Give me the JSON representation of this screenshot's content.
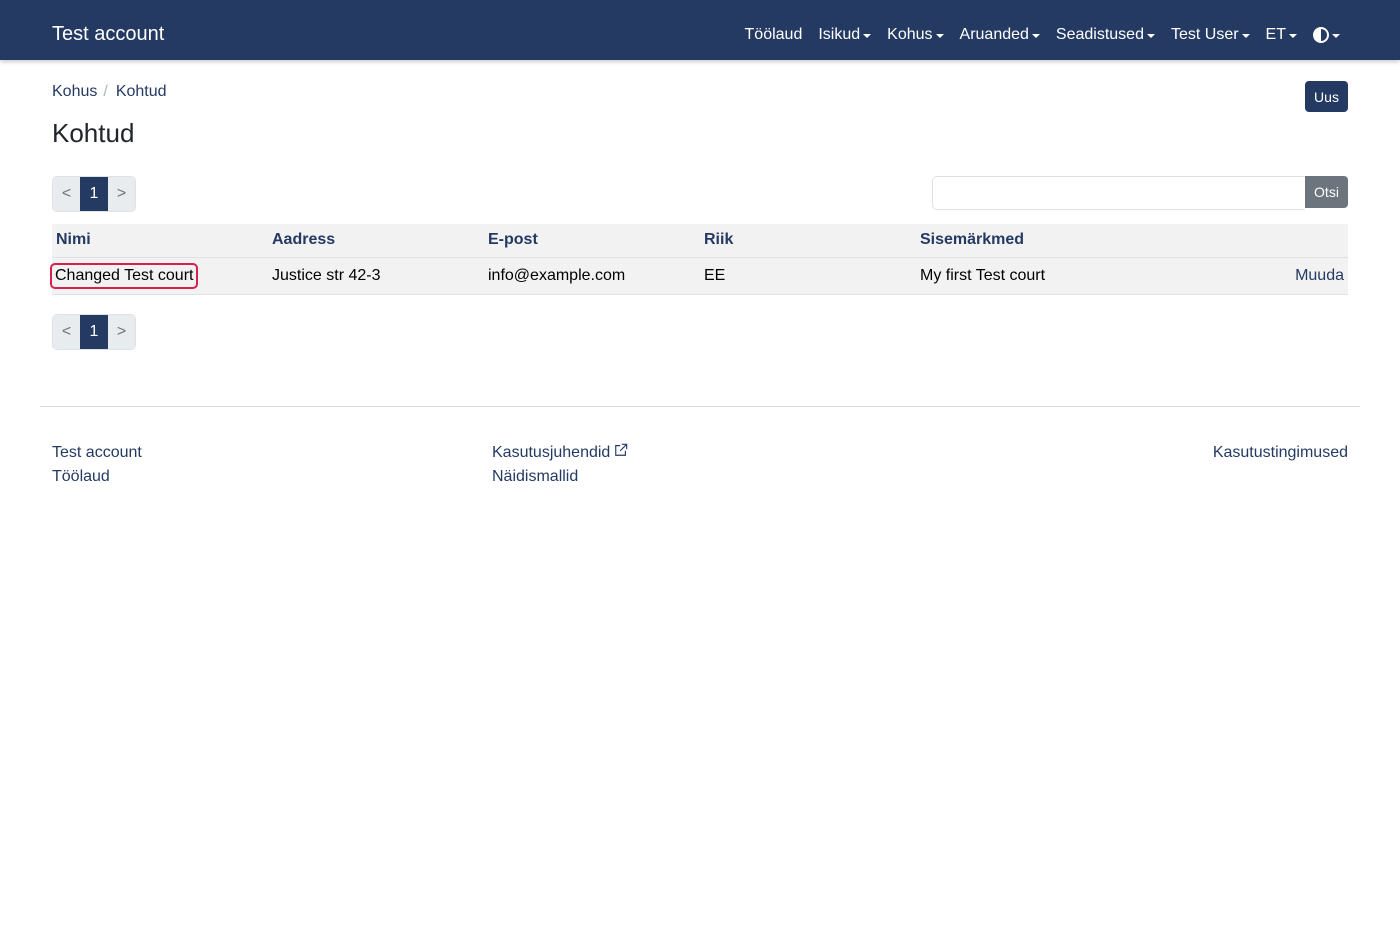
{
  "navbar": {
    "brand": "Test account",
    "items": [
      {
        "label": "Töölaud",
        "dropdown": false
      },
      {
        "label": "Isikud",
        "dropdown": true
      },
      {
        "label": "Kohus",
        "dropdown": true
      },
      {
        "label": "Aruanded",
        "dropdown": true
      },
      {
        "label": "Seadistused",
        "dropdown": true
      },
      {
        "label": "Test User",
        "dropdown": true
      },
      {
        "label": "ET",
        "dropdown": true
      }
    ],
    "theme_icon": "half-circle-icon"
  },
  "breadcrumb": {
    "items": [
      "Kohus",
      "Kohtud"
    ],
    "separator": "/"
  },
  "actions": {
    "new_label": "Uus"
  },
  "page": {
    "title": "Kohtud"
  },
  "pagination": {
    "prev": "<",
    "current": "1",
    "next": ">"
  },
  "search": {
    "value": "",
    "button_label": "Otsi"
  },
  "table": {
    "headers": [
      "Nimi",
      "Aadress",
      "E-post",
      "Riik",
      "Sisemärkmed"
    ],
    "rows": [
      {
        "name": "Changed Test court",
        "address": "Justice str 42-3",
        "email": "info@example.com",
        "country": "EE",
        "notes": "My first Test court",
        "edit_label": "Muuda"
      }
    ]
  },
  "footer": {
    "col1": [
      "Test account",
      "Töölaud"
    ],
    "col2": [
      "Kasutusjuhendid",
      "Näidismallid"
    ],
    "col3": [
      "Kasutustingimused"
    ],
    "external_icon": "external-link-icon"
  },
  "colors": {
    "primary": "#243a63",
    "highlight": "#d6204e",
    "secondary": "#6c757d"
  }
}
